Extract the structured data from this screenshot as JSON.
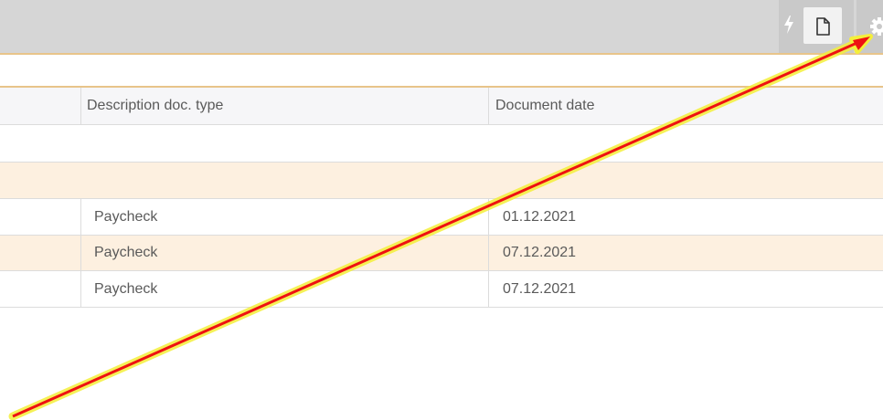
{
  "toolbar": {
    "flash_icon": "flash-icon",
    "doc_icon": "document-icon",
    "gear_icon": "gear-icon"
  },
  "table": {
    "columns": [
      {
        "label": "Description doc. type"
      },
      {
        "label": "Document date"
      }
    ],
    "rows": [
      {
        "description": "Paycheck",
        "date": "01.12.2021",
        "stripe": false
      },
      {
        "description": "Paycheck",
        "date": "07.12.2021",
        "stripe": true
      },
      {
        "description": "Paycheck",
        "date": "07.12.2021",
        "stripe": false
      }
    ]
  },
  "colors": {
    "accent_border": "#e8c48a",
    "stripe_row": "#fdf0e0",
    "toolbar_bg": "#d6d6d6",
    "annotation_arrow": "#ee1111",
    "annotation_glow": "#f4ef3a"
  }
}
